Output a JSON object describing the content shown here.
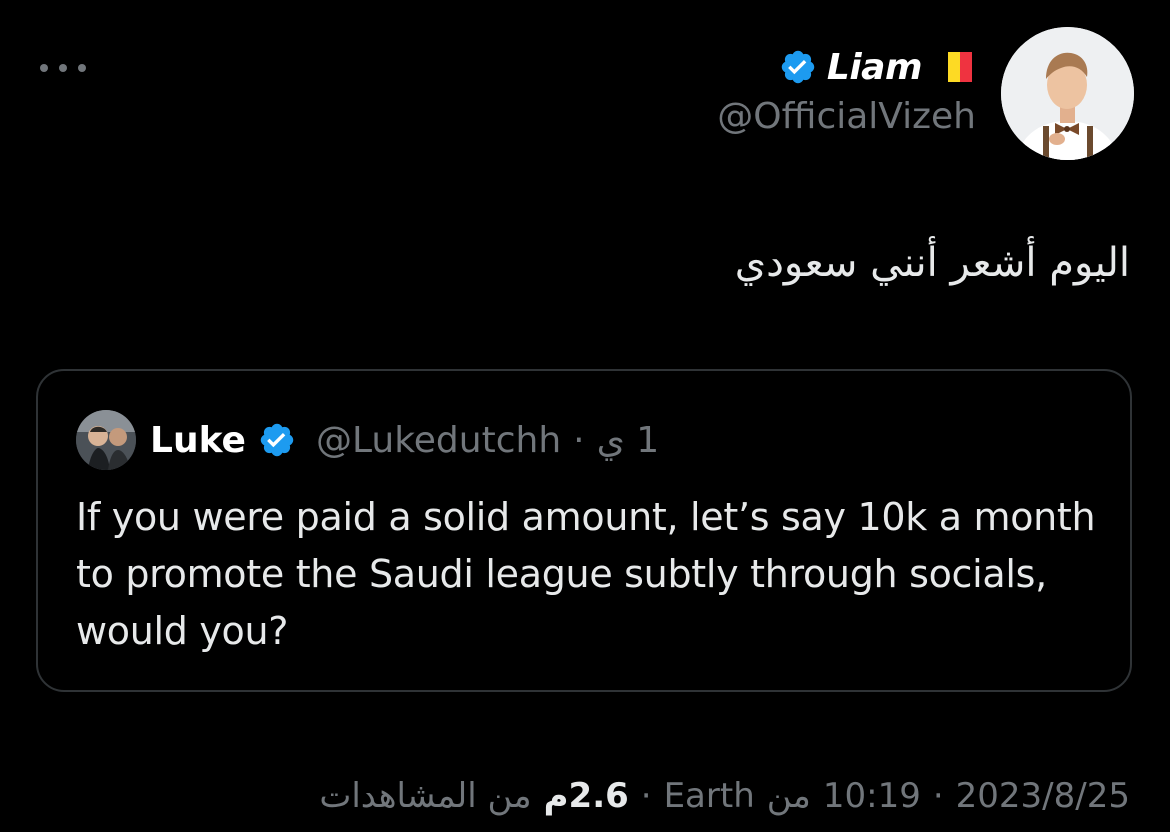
{
  "author": {
    "display_name": "Liam",
    "handle": "@OfficialVizeh",
    "verified_icon": "verified-badge-icon",
    "flag_icon": "belgium-flag-icon",
    "flag_colors": [
      "#000000",
      "#fdda24",
      "#ef3340"
    ]
  },
  "tweet": {
    "text": "اليوم أشعر أنني سعودي"
  },
  "quoted_tweet": {
    "display_name": "Luke",
    "handle": "@Lukedutchh",
    "separator": "·",
    "time_ago": "1 ي",
    "text": "If you were paid a solid amount, let’s say 10k a month to promote the Saudi league subtly through socials, would you?"
  },
  "meta": {
    "date": "2023/8/25",
    "sep1": "·",
    "time": "10:19",
    "source_prefix": "من",
    "source": "Earth",
    "sep2": "·",
    "views_count": "2.6م",
    "views_label": "من المشاهدات"
  },
  "colors": {
    "background": "#000000",
    "text_primary": "#e7e9ea",
    "text_secondary": "#71767b",
    "border": "#2f3336",
    "verified_blue": "#1d9bf0"
  }
}
